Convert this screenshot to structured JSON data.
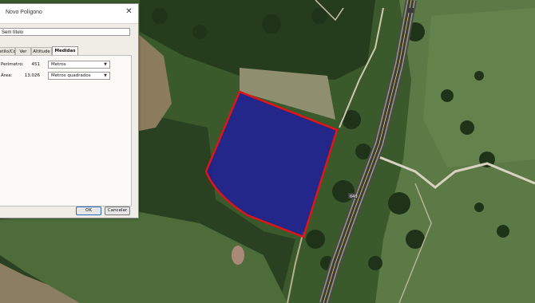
{
  "dialog": {
    "title": "Novo Polígono",
    "name_value": "Sem título",
    "tabs": [
      {
        "label": "Estilo/Cor"
      },
      {
        "label": "Ver"
      },
      {
        "label": "Altitude"
      },
      {
        "label": "Medidas"
      }
    ],
    "measurements": {
      "perimeter_label": "Perímetro:",
      "perimeter_value": "451",
      "perimeter_unit": "Metros",
      "area_label": "Área:",
      "area_value": "13.026",
      "area_unit": "Metros quadrados"
    },
    "buttons": {
      "ok": "OK",
      "cancel": "Cancelar"
    }
  },
  "map": {
    "road_shield_label": "040",
    "polygon_fill": "#1e1e9a",
    "polygon_border": "#e01515"
  }
}
